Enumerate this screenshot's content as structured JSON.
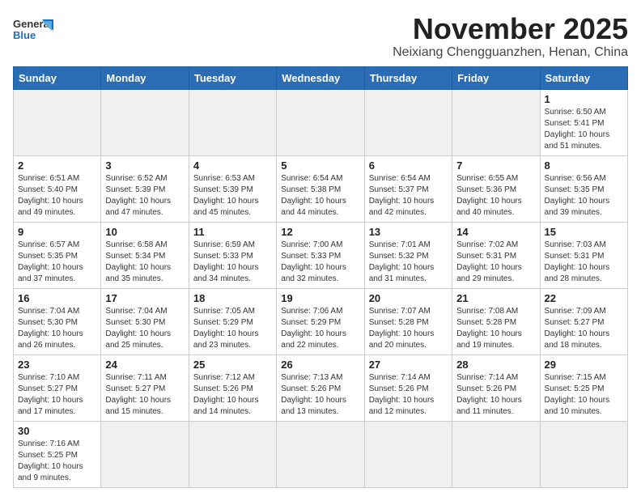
{
  "header": {
    "logo_general": "General",
    "logo_blue": "Blue",
    "month_title": "November 2025",
    "location": "Neixiang Chengguanzhen, Henan, China"
  },
  "weekdays": [
    "Sunday",
    "Monday",
    "Tuesday",
    "Wednesday",
    "Thursday",
    "Friday",
    "Saturday"
  ],
  "days": [
    {
      "date": "",
      "sunrise": "",
      "sunset": "",
      "daylight": ""
    },
    {
      "date": "",
      "sunrise": "",
      "sunset": "",
      "daylight": ""
    },
    {
      "date": "",
      "sunrise": "",
      "sunset": "",
      "daylight": ""
    },
    {
      "date": "",
      "sunrise": "",
      "sunset": "",
      "daylight": ""
    },
    {
      "date": "",
      "sunrise": "",
      "sunset": "",
      "daylight": ""
    },
    {
      "date": "",
      "sunrise": "",
      "sunset": "",
      "daylight": ""
    },
    {
      "date": "1",
      "sunrise": "Sunrise: 6:50 AM",
      "sunset": "Sunset: 5:41 PM",
      "daylight": "Daylight: 10 hours and 51 minutes."
    },
    {
      "date": "2",
      "sunrise": "Sunrise: 6:51 AM",
      "sunset": "Sunset: 5:40 PM",
      "daylight": "Daylight: 10 hours and 49 minutes."
    },
    {
      "date": "3",
      "sunrise": "Sunrise: 6:52 AM",
      "sunset": "Sunset: 5:39 PM",
      "daylight": "Daylight: 10 hours and 47 minutes."
    },
    {
      "date": "4",
      "sunrise": "Sunrise: 6:53 AM",
      "sunset": "Sunset: 5:39 PM",
      "daylight": "Daylight: 10 hours and 45 minutes."
    },
    {
      "date": "5",
      "sunrise": "Sunrise: 6:54 AM",
      "sunset": "Sunset: 5:38 PM",
      "daylight": "Daylight: 10 hours and 44 minutes."
    },
    {
      "date": "6",
      "sunrise": "Sunrise: 6:54 AM",
      "sunset": "Sunset: 5:37 PM",
      "daylight": "Daylight: 10 hours and 42 minutes."
    },
    {
      "date": "7",
      "sunrise": "Sunrise: 6:55 AM",
      "sunset": "Sunset: 5:36 PM",
      "daylight": "Daylight: 10 hours and 40 minutes."
    },
    {
      "date": "8",
      "sunrise": "Sunrise: 6:56 AM",
      "sunset": "Sunset: 5:35 PM",
      "daylight": "Daylight: 10 hours and 39 minutes."
    },
    {
      "date": "9",
      "sunrise": "Sunrise: 6:57 AM",
      "sunset": "Sunset: 5:35 PM",
      "daylight": "Daylight: 10 hours and 37 minutes."
    },
    {
      "date": "10",
      "sunrise": "Sunrise: 6:58 AM",
      "sunset": "Sunset: 5:34 PM",
      "daylight": "Daylight: 10 hours and 35 minutes."
    },
    {
      "date": "11",
      "sunrise": "Sunrise: 6:59 AM",
      "sunset": "Sunset: 5:33 PM",
      "daylight": "Daylight: 10 hours and 34 minutes."
    },
    {
      "date": "12",
      "sunrise": "Sunrise: 7:00 AM",
      "sunset": "Sunset: 5:33 PM",
      "daylight": "Daylight: 10 hours and 32 minutes."
    },
    {
      "date": "13",
      "sunrise": "Sunrise: 7:01 AM",
      "sunset": "Sunset: 5:32 PM",
      "daylight": "Daylight: 10 hours and 31 minutes."
    },
    {
      "date": "14",
      "sunrise": "Sunrise: 7:02 AM",
      "sunset": "Sunset: 5:31 PM",
      "daylight": "Daylight: 10 hours and 29 minutes."
    },
    {
      "date": "15",
      "sunrise": "Sunrise: 7:03 AM",
      "sunset": "Sunset: 5:31 PM",
      "daylight": "Daylight: 10 hours and 28 minutes."
    },
    {
      "date": "16",
      "sunrise": "Sunrise: 7:04 AM",
      "sunset": "Sunset: 5:30 PM",
      "daylight": "Daylight: 10 hours and 26 minutes."
    },
    {
      "date": "17",
      "sunrise": "Sunrise: 7:04 AM",
      "sunset": "Sunset: 5:30 PM",
      "daylight": "Daylight: 10 hours and 25 minutes."
    },
    {
      "date": "18",
      "sunrise": "Sunrise: 7:05 AM",
      "sunset": "Sunset: 5:29 PM",
      "daylight": "Daylight: 10 hours and 23 minutes."
    },
    {
      "date": "19",
      "sunrise": "Sunrise: 7:06 AM",
      "sunset": "Sunset: 5:29 PM",
      "daylight": "Daylight: 10 hours and 22 minutes."
    },
    {
      "date": "20",
      "sunrise": "Sunrise: 7:07 AM",
      "sunset": "Sunset: 5:28 PM",
      "daylight": "Daylight: 10 hours and 20 minutes."
    },
    {
      "date": "21",
      "sunrise": "Sunrise: 7:08 AM",
      "sunset": "Sunset: 5:28 PM",
      "daylight": "Daylight: 10 hours and 19 minutes."
    },
    {
      "date": "22",
      "sunrise": "Sunrise: 7:09 AM",
      "sunset": "Sunset: 5:27 PM",
      "daylight": "Daylight: 10 hours and 18 minutes."
    },
    {
      "date": "23",
      "sunrise": "Sunrise: 7:10 AM",
      "sunset": "Sunset: 5:27 PM",
      "daylight": "Daylight: 10 hours and 17 minutes."
    },
    {
      "date": "24",
      "sunrise": "Sunrise: 7:11 AM",
      "sunset": "Sunset: 5:27 PM",
      "daylight": "Daylight: 10 hours and 15 minutes."
    },
    {
      "date": "25",
      "sunrise": "Sunrise: 7:12 AM",
      "sunset": "Sunset: 5:26 PM",
      "daylight": "Daylight: 10 hours and 14 minutes."
    },
    {
      "date": "26",
      "sunrise": "Sunrise: 7:13 AM",
      "sunset": "Sunset: 5:26 PM",
      "daylight": "Daylight: 10 hours and 13 minutes."
    },
    {
      "date": "27",
      "sunrise": "Sunrise: 7:14 AM",
      "sunset": "Sunset: 5:26 PM",
      "daylight": "Daylight: 10 hours and 12 minutes."
    },
    {
      "date": "28",
      "sunrise": "Sunrise: 7:14 AM",
      "sunset": "Sunset: 5:26 PM",
      "daylight": "Daylight: 10 hours and 11 minutes."
    },
    {
      "date": "29",
      "sunrise": "Sunrise: 7:15 AM",
      "sunset": "Sunset: 5:25 PM",
      "daylight": "Daylight: 10 hours and 10 minutes."
    },
    {
      "date": "30",
      "sunrise": "Sunrise: 7:16 AM",
      "sunset": "Sunset: 5:25 PM",
      "daylight": "Daylight: 10 hours and 9 minutes."
    }
  ]
}
